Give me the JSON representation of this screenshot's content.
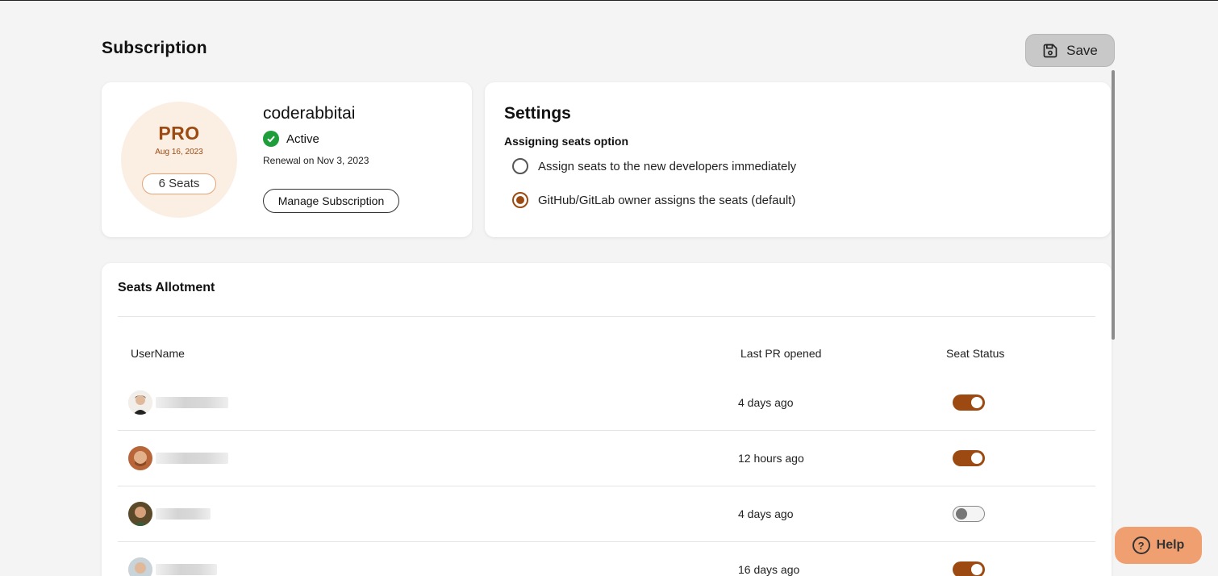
{
  "page": {
    "title": "Subscription",
    "save_label": "Save"
  },
  "subscription": {
    "plan": "PRO",
    "plan_date": "Aug 16, 2023",
    "seats_label": "6 Seats",
    "org_name": "coderabbitai",
    "status": "Active",
    "renewal": "Renewal on Nov 3, 2023",
    "manage_label": "Manage Subscription"
  },
  "settings": {
    "title": "Settings",
    "subtitle": "Assigning seats option",
    "options": [
      {
        "label": "Assign seats to the new developers immediately",
        "checked": false
      },
      {
        "label": "GitHub/GitLab owner assigns the seats (default)",
        "checked": true
      }
    ]
  },
  "seats": {
    "title": "Seats Allotment",
    "columns": [
      "UserName",
      "Last PR opened",
      "Seat Status"
    ],
    "rows": [
      {
        "last_pr": "4 days ago",
        "active": true
      },
      {
        "last_pr": "12 hours ago",
        "active": true
      },
      {
        "last_pr": "4 days ago",
        "active": false
      },
      {
        "last_pr": "16 days ago",
        "active": true
      }
    ]
  },
  "help": {
    "label": "Help"
  },
  "colors": {
    "accent": "#9c4a12",
    "success": "#1e9e3a",
    "help_bg": "#f0a070"
  }
}
